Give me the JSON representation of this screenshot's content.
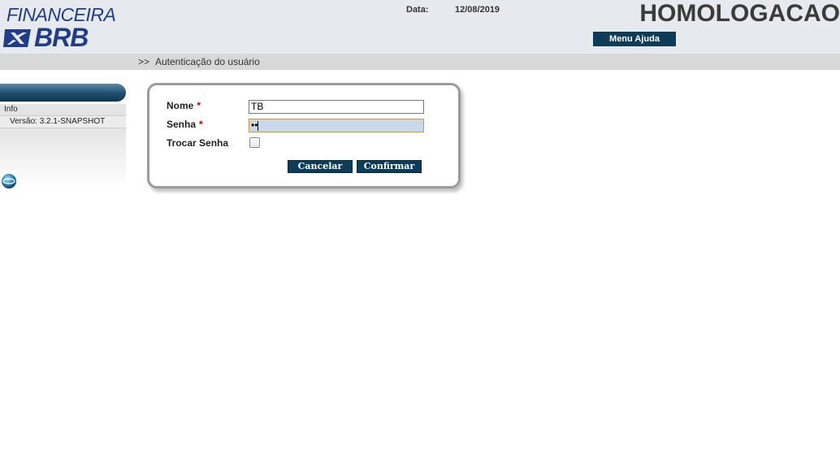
{
  "header": {
    "logo_line1": "FINANCEIRA",
    "logo_line2": "BRB",
    "date_label": "Data:",
    "date_value": "12/08/2019",
    "environment": "HOMOLOGACAO",
    "help_menu_label": "Menu Ajuda",
    "brand_color": "#1f3d8b"
  },
  "breadcrumb": {
    "prefix": ">>",
    "text": "Autenticação do usuário"
  },
  "sidebar": {
    "info_label": "Info",
    "version_label": "Versão: 3.2.1-SNAPSHOT"
  },
  "login_form": {
    "username_label": "Nome",
    "username_value": "TB",
    "password_label": "Senha",
    "password_masked": "••",
    "change_password_label": "Trocar Senha",
    "change_password_checked": false,
    "required_marker": "*",
    "cancel_label": "Cancelar",
    "confirm_label": "Confirmar"
  },
  "colors": {
    "button_bg": "#0d3c59",
    "required": "#cc0000",
    "focus_border": "#e0962c"
  }
}
